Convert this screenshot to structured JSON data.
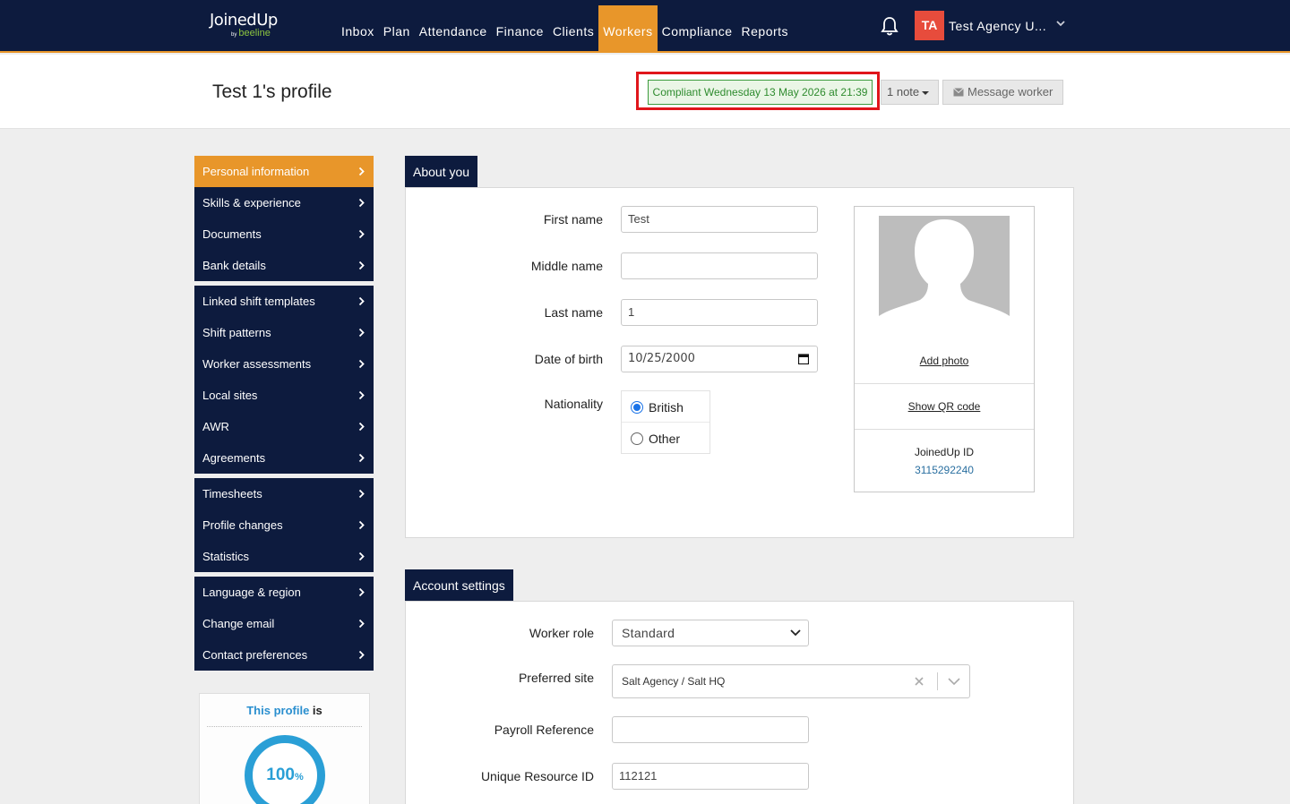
{
  "nav": {
    "logo_main": "JoinedUp",
    "logo_by": "by",
    "logo_sub": "beeline",
    "items": [
      "Inbox",
      "Plan",
      "Attendance",
      "Finance",
      "Clients",
      "Workers",
      "Compliance",
      "Reports"
    ],
    "active": "Workers",
    "user_initials": "TA",
    "user_name": "Test Agency U...",
    "avatar_color": "#e74c3c",
    "accent_color": "#e8962a",
    "nav_bg_color": "#0d1b3e"
  },
  "header": {
    "title": "Test 1's profile",
    "compliance_status": "Compliant Wednesday 13 May 2026 at 21:39",
    "note_button": "1 note",
    "message_button": "Message worker"
  },
  "sidebar": {
    "groups": [
      [
        "Personal information",
        "Skills & experience",
        "Documents",
        "Bank details"
      ],
      [
        "Linked shift templates",
        "Shift patterns",
        "Worker assessments",
        "Local sites",
        "AWR",
        "Agreements"
      ],
      [
        "Timesheets",
        "Profile changes",
        "Statistics"
      ],
      [
        "Language & region",
        "Change email",
        "Contact preferences"
      ]
    ],
    "active": "Personal information",
    "profile_card": {
      "title_highlight": "This profile",
      "title_rest": "is",
      "percent": "100",
      "percent_unit": "%",
      "completion": 1.0
    }
  },
  "about": {
    "tab": "About you",
    "first_name_label": "First name",
    "first_name_value": "Test",
    "middle_name_label": "Middle name",
    "middle_name_value": "",
    "last_name_label": "Last name",
    "last_name_value": "1",
    "dob_label": "Date of birth",
    "dob_value": "10/25/2000",
    "nationality_label": "Nationality",
    "nationality_options": [
      "British",
      "Other"
    ],
    "nationality_selected": "British",
    "add_photo": "Add photo",
    "show_qr": "Show QR code",
    "joinedup_id_label": "JoinedUp ID",
    "joinedup_id_value": "3115292240"
  },
  "account": {
    "tab": "Account settings",
    "worker_role_label": "Worker role",
    "worker_role_value": "Standard",
    "preferred_site_label": "Preferred site",
    "preferred_site_value": "Salt Agency / Salt HQ",
    "payroll_ref_label": "Payroll Reference",
    "payroll_ref_value": "",
    "unique_resource_label": "Unique Resource ID",
    "unique_resource_value": "112121"
  }
}
